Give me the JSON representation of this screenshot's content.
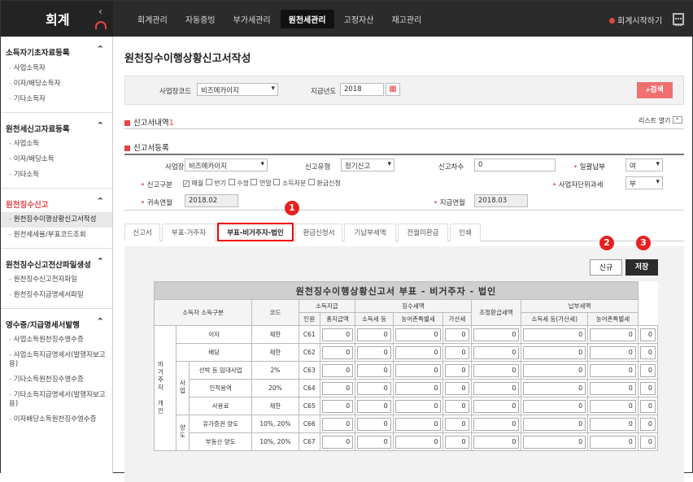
{
  "app": {
    "logo": "회계"
  },
  "nav": [
    "회계관리",
    "자동증빙",
    "부가세관리",
    "원천세관리",
    "고정자산",
    "재고관리"
  ],
  "header_right": {
    "start": "회계시작하기"
  },
  "sidebar": {
    "s1": {
      "title": "소득자기초자료등록",
      "items": [
        "사업소득자",
        "이자/배당소득자",
        "기타소득자"
      ]
    },
    "s2": {
      "title": "원천세신고자료등록",
      "items": [
        "사업소득",
        "이자/배당소득",
        "기타소득"
      ]
    },
    "s3": {
      "title": "원천징수신고",
      "items": [
        "원천징수이행상황신고서작성",
        "원천세세율/부표코드조회"
      ]
    },
    "s4": {
      "title": "원천징수신고전산파일생성",
      "items": [
        "원천징수신고전자파일",
        "원천징수지급명세서파일"
      ]
    },
    "s5": {
      "title": "영수증/지급명세서발행",
      "items": [
        "사업소득원천징수영수증",
        "사업소득지급명세서(발행자보고용)",
        "기타소득원천징수영수증",
        "기타소득지급명세서(발행자보고용)",
        "이자배당소득원천징수영수증"
      ]
    }
  },
  "page_title": "원천징수이행상황신고서작성",
  "search": {
    "biz_label": "사업장코드",
    "biz_value": "비즈메카이지",
    "year_label": "지급년도",
    "year_value": "2018",
    "button": "검색"
  },
  "report_list": {
    "title": "신고서내역",
    "count": "1",
    "toggle": "리스트 열기"
  },
  "report": {
    "title": "신고서등록",
    "biz_label": "사업장",
    "biz_value": "비즈메카이지",
    "type_label": "신고유형",
    "type_value": "정기신고",
    "seq_label": "신고차수",
    "seq_value": "0",
    "batch_label": "일괄납부",
    "batch_value": "여",
    "class_label": "신고구분",
    "class_opts": [
      "매월",
      "반기",
      "수정",
      "연말",
      "소득처분",
      "환급신청"
    ],
    "unit_label": "사업자단위과세",
    "unit_value": "부",
    "belong_label": "귀속연월",
    "belong_value": "2018.02",
    "pay_label": "지급연월",
    "pay_value": "2018.03"
  },
  "tabs": [
    "신고서",
    "부표-거주자",
    "부표-비거주자-법인",
    "환급신청서",
    "기납부세액",
    "전월미환급",
    "인쇄"
  ],
  "badges": [
    "1",
    "2",
    "3"
  ],
  "buttons": {
    "new": "신규",
    "save": "저장"
  },
  "table": {
    "title": "원천징수이행상황신고서 부표 - 비거주자 - 법인",
    "h_class": "소득자 소득구분",
    "h_code": "코드",
    "h_pay": "소득지급",
    "h_tax": "징수세액",
    "h_adj": "조정환급세액",
    "h_paid": "납부세액",
    "h_people": "인원",
    "h_amount": "총지급액",
    "h_income": "소득세 등",
    "h_rural": "농어촌특별세",
    "h_add": "가산세",
    "h_income2": "소득세 등(가산세)",
    "h_rural2": "농어촌특별세",
    "side1": "비거주자",
    "side2": "개인",
    "grp_biz": "사업",
    "grp_transfer": "양도",
    "rows": [
      {
        "name": "이자",
        "rate": "제한",
        "code": "C61"
      },
      {
        "name": "배당",
        "rate": "제한",
        "code": "C62"
      },
      {
        "name": "선박 등 임대사업",
        "rate": "2%",
        "code": "C63"
      },
      {
        "name": "인적용역",
        "rate": "20%",
        "code": "C64"
      },
      {
        "name": "사용료",
        "rate": "제한",
        "code": "C65"
      },
      {
        "name": "유가증권 양도",
        "rate": "10%, 20%",
        "code": "C66"
      },
      {
        "name": "부동산 양도",
        "rate": "10%, 20%",
        "code": "C67"
      }
    ],
    "zero": "0"
  }
}
